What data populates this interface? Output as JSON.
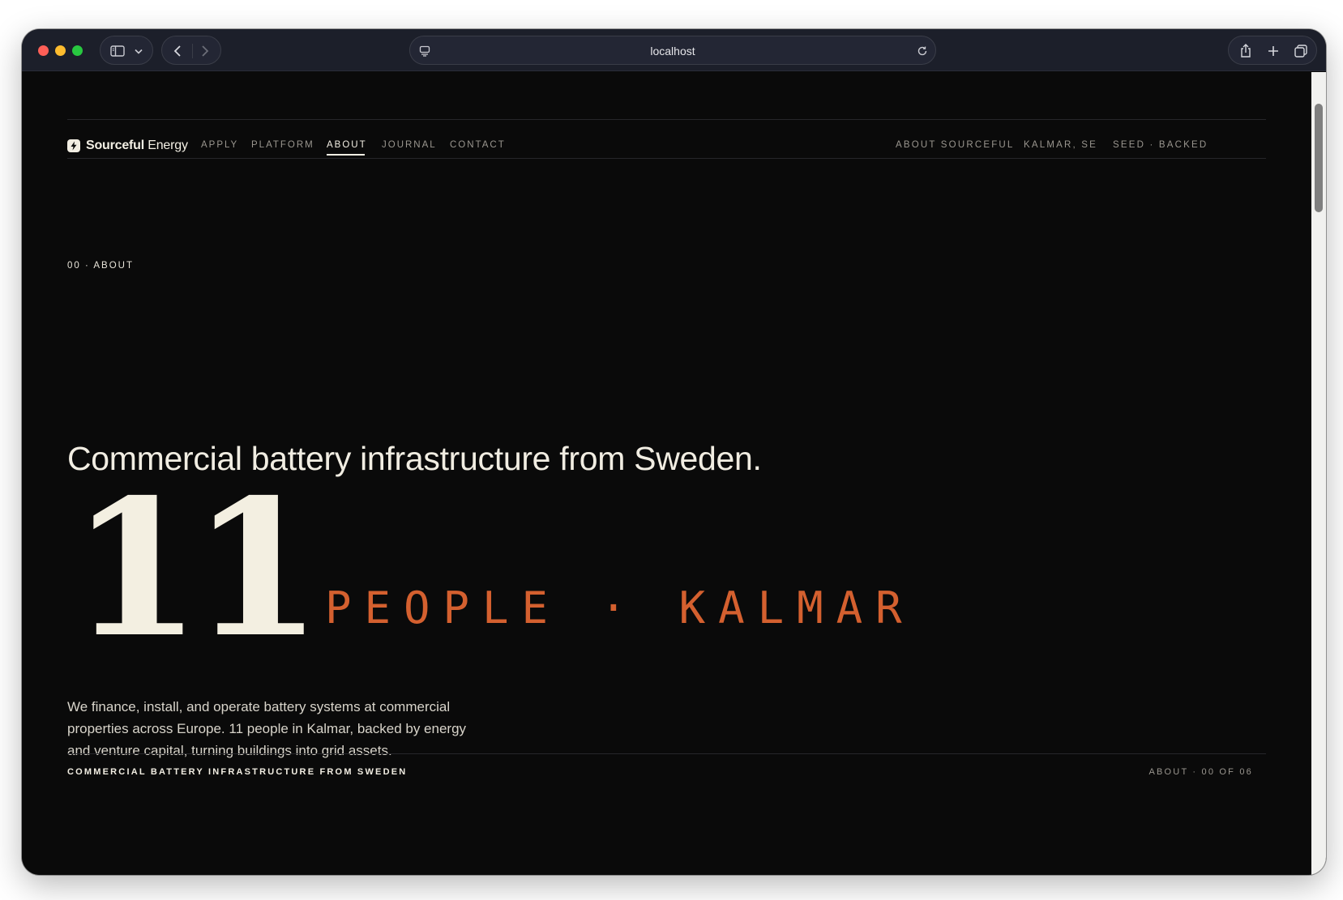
{
  "browser": {
    "url": "localhost"
  },
  "site": {
    "brand_bold": "Sourceful",
    "brand_rest": " Energy",
    "nav": [
      {
        "label": "APPLY"
      },
      {
        "label": "PLATFORM"
      },
      {
        "label": "ABOUT",
        "active": true
      },
      {
        "label": "JOURNAL"
      },
      {
        "label": "CONTACT"
      }
    ],
    "meta": [
      "ABOUT SOURCEFUL",
      "KALMAR, SE",
      "SEED · BACKED"
    ]
  },
  "hero": {
    "eyebrow": "00 · ABOUT",
    "headline": "Commercial battery infrastructure from Sweden.",
    "big_number": "11",
    "big_caption": "PEOPLE · KALMAR",
    "body": "We finance, install, and operate battery systems at commercial properties across Europe. 11 people in Kalmar, backed by energy and venture capital, turning buildings into grid assets."
  },
  "footer": {
    "left": "COMMERCIAL BATTERY INFRASTRUCTURE FROM SWEDEN",
    "right": "ABOUT · 00 OF 06"
  },
  "colors": {
    "background": "#0a0a0a",
    "text": "#f1ede2",
    "accent": "#d4602f",
    "muted": "#9a968f"
  }
}
